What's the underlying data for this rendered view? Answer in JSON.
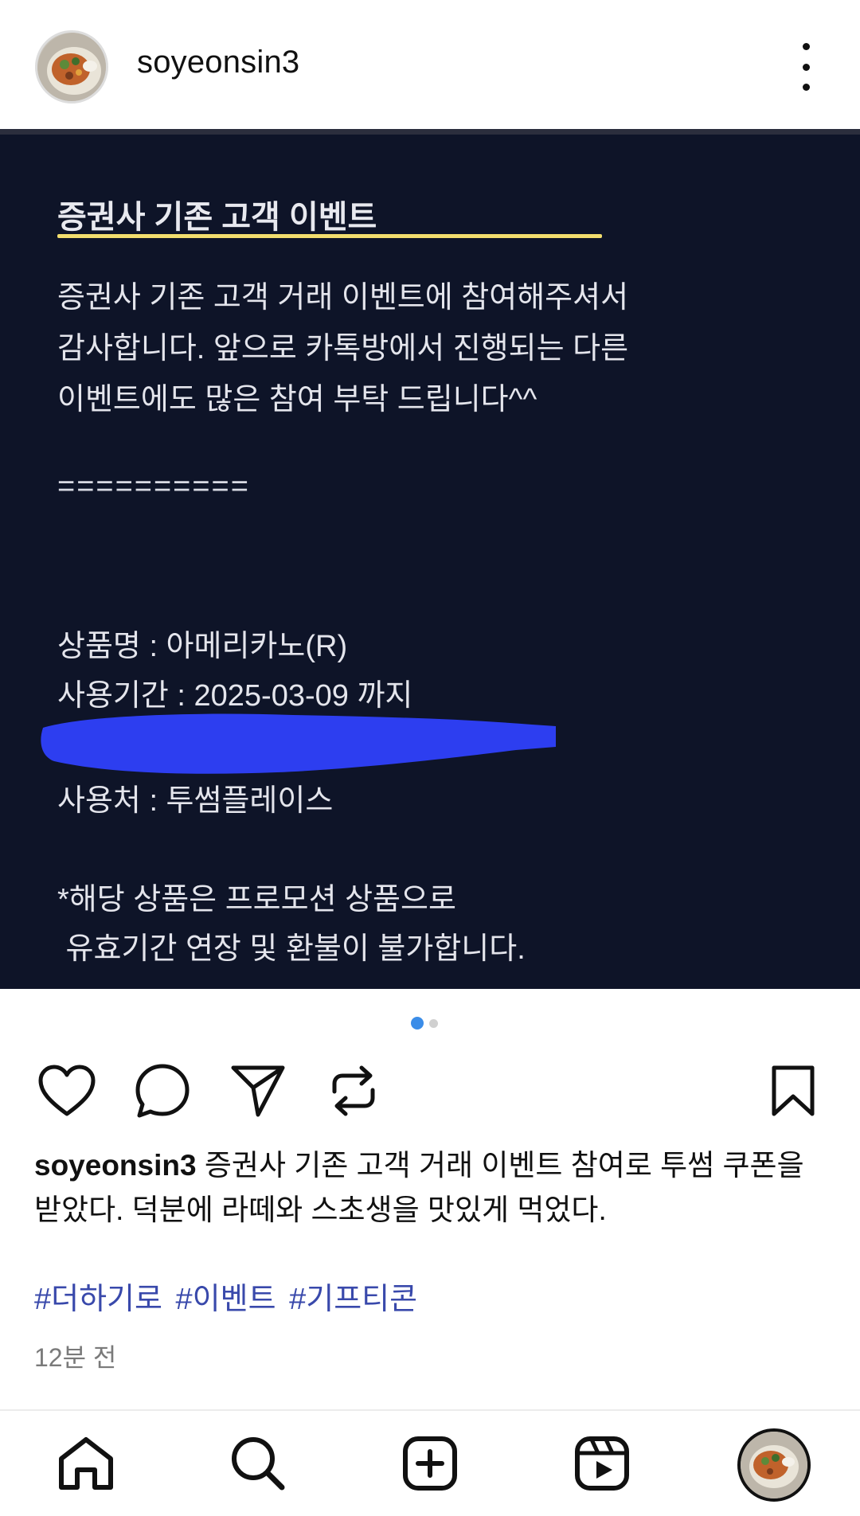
{
  "header": {
    "username": "soyeonsin3",
    "avatar_icon": "profile-avatar",
    "more_icon": "more-vertical-icon"
  },
  "post_image": {
    "title": "증권사 기존 고객 이벤트",
    "lines": [
      "증권사 기존 고객 거래 이벤트에 참여해주셔서",
      "감사합니다. 앞으로 카톡방에서 진행되는 다른",
      "이벤트에도 많은 참여 부탁 드립니다^^"
    ],
    "separator": "==========",
    "product_line": "상품명 : 아메리카노(R)",
    "period_line": "사용기간 : 2025-03-09 까지",
    "place_line": "사용처 : 투썸플레이스",
    "note_line1": "*해당 상품은 프로모션 상품으로",
    "note_line2": " 유효기간 연장 및 환불이 불가합니다.",
    "redaction_color": "#2d3ef0",
    "background_color": "#0e1428",
    "underline_color": "#f2de6e"
  },
  "carousel": {
    "current": 1,
    "total": 2,
    "active_color": "#3b8de8"
  },
  "actions": {
    "like_icon": "heart-icon",
    "comment_icon": "comment-icon",
    "share_icon": "send-icon",
    "repost_icon": "repost-icon",
    "save_icon": "bookmark-icon"
  },
  "caption": {
    "username": "soyeonsin3",
    "text": " 증권사 기존 고객 거래 이벤트 참여로 투썸 쿠폰을 받았다. 덕분에 라떼와 스초생을 맛있게 먹었다."
  },
  "hashtags": "#더하기로 #이벤트 #기프티콘",
  "timestamp": "12분 전",
  "bottom_nav": [
    "home-icon",
    "search-icon",
    "create-icon",
    "reels-icon",
    "profile-avatar"
  ]
}
